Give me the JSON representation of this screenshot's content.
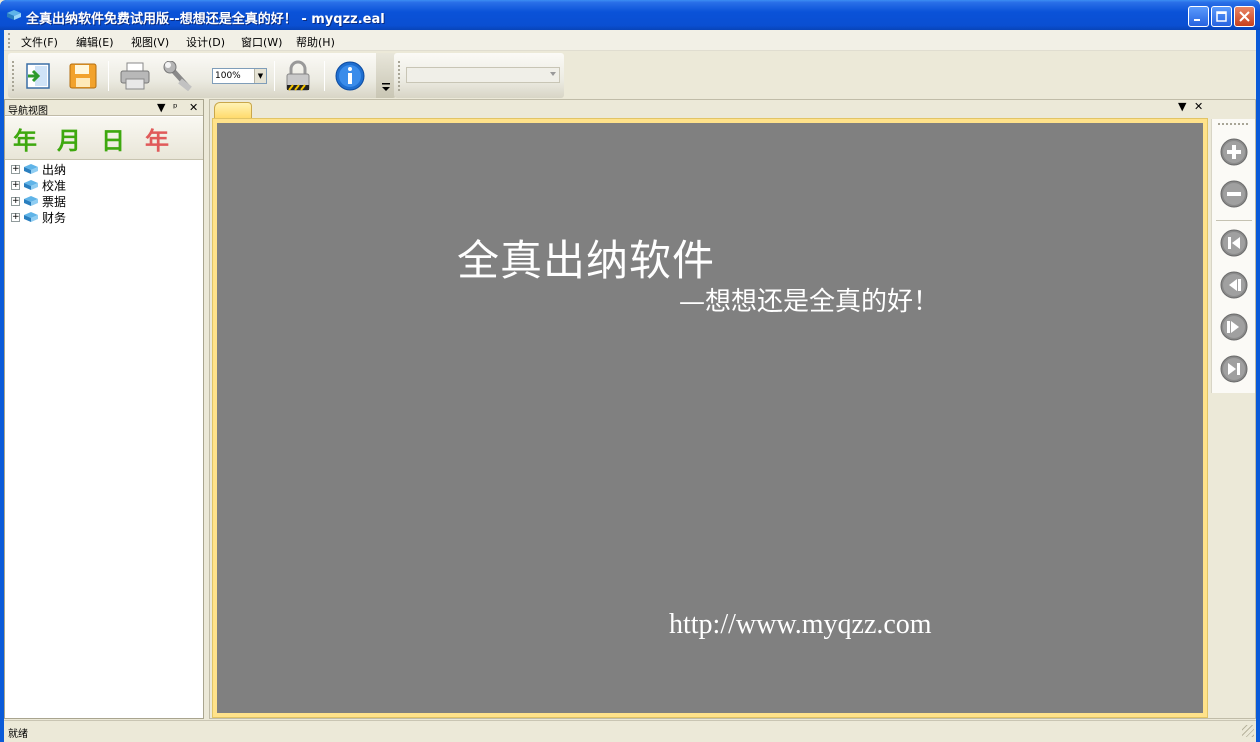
{
  "window": {
    "title": "全真出纳软件免费试用版--想想还是全真的好！ - myqzz.eal"
  },
  "menu": {
    "items": [
      "文件(F)",
      "编辑(E)",
      "视图(V)",
      "设计(D)",
      "窗口(W)",
      "帮助(H)"
    ]
  },
  "toolbar": {
    "zoom_value": "100%",
    "icons": [
      "exit-icon",
      "save-icon",
      "print-icon",
      "tools-icon",
      "lock-icon",
      "info-icon"
    ]
  },
  "nav": {
    "title": "导航视图",
    "banner": [
      "年",
      "月",
      "日",
      "年"
    ],
    "tree": [
      "出纳",
      "校准",
      "票据",
      "财务"
    ]
  },
  "document": {
    "main_title": "全真出纳软件",
    "sub_title": "—想想还是全真的好！",
    "url": "http://www.myqzz.com",
    "canvas_color": "#808080"
  },
  "status": {
    "text": "就绪"
  },
  "colors": {
    "title_bar": "#0a52d8",
    "doc_border": "#ffe28a",
    "banner_green": "#3ea80f",
    "banner_red": "#e05a5a"
  }
}
